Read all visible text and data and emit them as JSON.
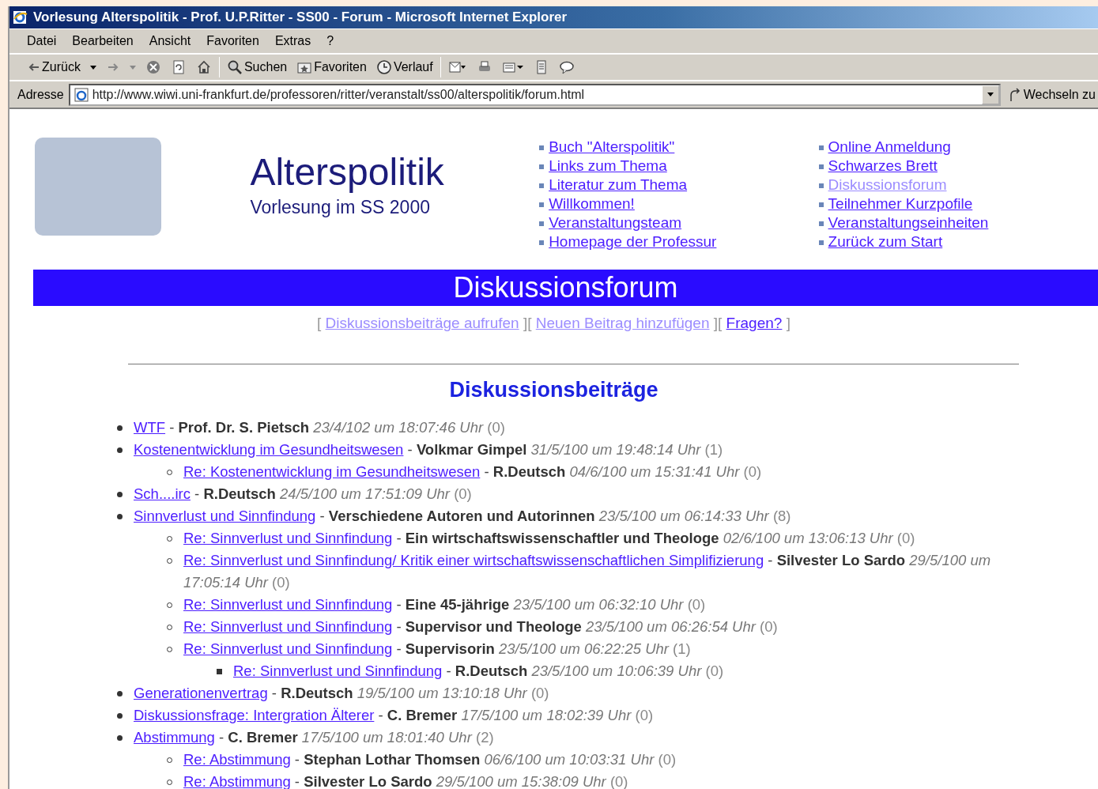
{
  "window": {
    "title": "Vorlesung Alterspolitik - Prof. U.P.Ritter - SS00 - Forum - Microsoft Internet Explorer"
  },
  "menu": [
    "Datei",
    "Bearbeiten",
    "Ansicht",
    "Favoriten",
    "Extras",
    "?"
  ],
  "toolbar": {
    "back": "Zurück",
    "search": "Suchen",
    "favorites": "Favoriten",
    "history": "Verlauf"
  },
  "address_bar": {
    "label": "Adresse",
    "value": "http://www.wiwi.uni-frankfurt.de/professoren/ritter/veranstalt/ss00/alterspolitik/forum.html",
    "go": "Wechseln zu"
  },
  "header": {
    "title": "Alterspolitik",
    "subtitle": "Vorlesung im SS 2000",
    "links_left": [
      {
        "label": "Buch \"Alterspolitik\"",
        "visited": false
      },
      {
        "label": "Links zum Thema",
        "visited": false
      },
      {
        "label": "Literatur zum Thema",
        "visited": false
      },
      {
        "label": "Willkommen!",
        "visited": false
      },
      {
        "label": "Veranstaltungsteam",
        "visited": false
      },
      {
        "label": "Homepage der Professur",
        "visited": false
      }
    ],
    "links_right": [
      {
        "label": "Online Anmeldung",
        "visited": false
      },
      {
        "label": "Schwarzes Brett",
        "visited": false
      },
      {
        "label": "Diskussionsforum",
        "visited": true
      },
      {
        "label": "Teilnehmer Kurzpofile",
        "visited": false
      },
      {
        "label": "Veranstaltungseinheiten",
        "visited": false
      },
      {
        "label": "Zurück zum Start",
        "visited": false
      }
    ]
  },
  "banner": "Diskussionsforum",
  "forum_nav": [
    {
      "kind": "bracket",
      "label": "["
    },
    {
      "kind": "link",
      "label": "Diskussionsbeiträge aufrufen",
      "visited": true
    },
    {
      "kind": "bracket",
      "label": "]["
    },
    {
      "kind": "link",
      "label": "Neuen Beitrag hinzufügen",
      "visited": true
    },
    {
      "kind": "bracket",
      "label": "]["
    },
    {
      "kind": "link",
      "label": "Fragen?",
      "visited": false
    },
    {
      "kind": "bracket",
      "label": "]"
    }
  ],
  "heading": "Diskussionsbeiträge",
  "posts": [
    {
      "title": "WTF",
      "separator": "-",
      "author": "Prof. Dr. S. Pietsch",
      "date": "23/4/102 um 18:07:46 Uhr",
      "replies": "(0)"
    },
    {
      "title": "Kostenentwicklung im Gesundheitswesen",
      "separator": "-",
      "author": "Volkmar Gimpel",
      "date": "31/5/100 um 19:48:14 Uhr",
      "replies": "(1)",
      "children": [
        {
          "title": "Re: Kostenentwicklung im Gesundheitswesen",
          "separator": "-",
          "author": "R.Deutsch",
          "date": "04/6/100 um 15:31:41 Uhr",
          "replies": "(0)"
        }
      ]
    },
    {
      "title": "Sch....irc",
      "separator": "-",
      "author": "R.Deutsch",
      "date": "24/5/100 um 17:51:09 Uhr",
      "replies": "(0)"
    },
    {
      "title": "Sinnverlust und Sinnfindung",
      "separator": "-",
      "author": "Verschiedene Autoren und Autorinnen",
      "date": "23/5/100 um 06:14:33 Uhr",
      "replies": "(8)",
      "children": [
        {
          "title": "Re: Sinnverlust und Sinnfindung",
          "separator": "-",
          "author": "Ein wirtschaftswissenschaftler und Theologe",
          "date": "02/6/100 um 13:06:13 Uhr",
          "replies": "(0)"
        },
        {
          "title": "Re: Sinnverlust und Sinnfindung/ Kritik einer wirtschaftswissenschaftlichen Simplifizierung",
          "separator": "-",
          "author": "Silvester Lo Sardo",
          "date": "29/5/100 um 17:05:14 Uhr",
          "replies": "(0)"
        },
        {
          "title": "Re: Sinnverlust und Sinnfindung",
          "separator": "-",
          "author": "Eine 45-jährige",
          "date": "23/5/100 um 06:32:10 Uhr",
          "replies": "(0)"
        },
        {
          "title": "Re: Sinnverlust und Sinnfindung",
          "separator": "-",
          "author": "Supervisor und Theologe",
          "date": "23/5/100 um 06:26:54 Uhr",
          "replies": "(0)"
        },
        {
          "title": "Re: Sinnverlust und Sinnfindung",
          "separator": "-",
          "author": "Supervisorin",
          "date": "23/5/100 um 06:22:25 Uhr",
          "replies": "(1)",
          "children": [
            {
              "title": "Re: Sinnverlust und Sinnfindung",
              "separator": "-",
              "author": "R.Deutsch",
              "date": "23/5/100 um 10:06:39 Uhr",
              "replies": "(0)"
            }
          ]
        }
      ]
    },
    {
      "title": "Generationenvertrag",
      "separator": "-",
      "author": "R.Deutsch",
      "date": "19/5/100 um 13:10:18 Uhr",
      "replies": "(0)"
    },
    {
      "title": "Diskussionsfrage: Intergration Älterer",
      "separator": "-",
      "author": "C. Bremer",
      "date": "17/5/100 um 18:02:39 Uhr",
      "replies": "(0)"
    },
    {
      "title": "Abstimmung",
      "separator": "-",
      "author": "C. Bremer",
      "date": "17/5/100 um 18:01:40 Uhr",
      "replies": "(2)",
      "children": [
        {
          "title": "Re: Abstimmung",
          "separator": "-",
          "author": "Stephan Lothar Thomsen",
          "date": "06/6/100 um 10:03:31 Uhr",
          "replies": "(0)"
        },
        {
          "title": "Re: Abstimmung",
          "separator": "-",
          "author": "Silvester Lo Sardo",
          "date": "29/5/100 um 15:38:09 Uhr",
          "replies": "(0)"
        }
      ]
    }
  ]
}
